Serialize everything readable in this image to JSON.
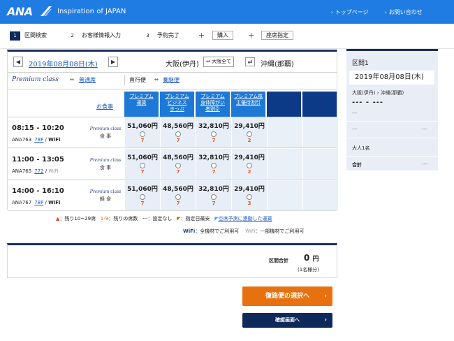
{
  "header": {
    "logo": "ANA",
    "tagline": "Inspiration of JAPAN",
    "nav": [
      "トップページ",
      "お問い合わせ"
    ]
  },
  "steps": [
    {
      "num": "1",
      "label": "区間検索"
    },
    {
      "num": "2",
      "label": "お客様情報入力"
    },
    {
      "num": "3",
      "label": "予約完了"
    },
    {
      "num": "+",
      "label": "購入"
    },
    {
      "num": "+",
      "label": "座席指定"
    }
  ],
  "search": {
    "prev": "◀",
    "date": "2019年08月08日(木)",
    "next": "▶",
    "from": "大阪(伊丹)",
    "from_chip": "大阪全て",
    "swap": "⇄",
    "to": "沖縄(那覇)"
  },
  "class_row": {
    "premium": "Premium class",
    "ordinary": "普通席",
    "direct": "直行便",
    "connecting": "乗継便"
  },
  "columns": {
    "meal": "お食事",
    "fares": [
      [
        "プレミアム",
        "運賃"
      ],
      [
        "プレミアム",
        "ビジネス",
        "きっぷ"
      ],
      [
        "プレミアム",
        "身体障がい",
        "者割引"
      ],
      [
        "プレミアム株",
        "主優待割引"
      ]
    ]
  },
  "flights": [
    {
      "time": "08:15 - 10:20",
      "flight": "ANA763",
      "aircraft": "78P",
      "wifi": "WiFi",
      "wifi_all": true,
      "meal_class": "Premium class",
      "meal": "食 事",
      "fares": [
        {
          "price": "51,060円",
          "seats": "7"
        },
        {
          "price": "48,560円",
          "seats": "7"
        },
        {
          "price": "32,810円",
          "seats": "7"
        },
        {
          "price": "29,410円",
          "seats": "2"
        }
      ]
    },
    {
      "time": "11:00 - 13:05",
      "flight": "ANA765",
      "aircraft": "772",
      "wifi": "WiFi",
      "wifi_all": false,
      "meal_class": "Premium class",
      "meal": "食 事",
      "fares": [
        {
          "price": "51,060円",
          "seats": "7"
        },
        {
          "price": "48,560円",
          "seats": "7"
        },
        {
          "price": "32,810円",
          "seats": "7"
        },
        {
          "price": "29,410円",
          "seats": "2"
        }
      ]
    },
    {
      "time": "14:00 - 16:10",
      "flight": "ANA767",
      "aircraft": "78P",
      "wifi": "WiFi",
      "wifi_all": true,
      "meal_class": "Premium class",
      "meal": "軽 食",
      "fares": [
        {
          "price": "51,060円",
          "seats": "7"
        },
        {
          "price": "48,560円",
          "seats": "7"
        },
        {
          "price": "32,810円",
          "seats": "7"
        },
        {
          "price": "29,410円",
          "seats": "3"
        }
      ]
    }
  ],
  "legend": {
    "tri": "▲",
    "tri_text": "：残り10~29席",
    "range": "1-9",
    "range_text": "：残りの席数",
    "dash": "---",
    "dash_text": "：設定なし",
    "flag_text": "：指定日最安",
    "link_text": "空席予測に連動した運賃",
    "wifi_all": "WiFi",
    "wifi_all_text": "：全機材でご利用可",
    "wifi_some": "WiFi",
    "wifi_some_text": "：一部機材でご利用可"
  },
  "total": {
    "label": "区間合計",
    "value": "0",
    "unit": "円",
    "note": "(1名様分)"
  },
  "buttons": {
    "return": "復路便の選択へ",
    "confirm": "確認画面へ"
  },
  "summary": {
    "section": "区間1",
    "date": "2019年08月08日(木)",
    "route": "大阪(伊丹) › 沖縄(那覇)",
    "times": "--- - ---",
    "flight": "---",
    "left": "---",
    "right": "---",
    "pax": "大人1名",
    "sum_label": "合計",
    "sum_value": "---"
  }
}
